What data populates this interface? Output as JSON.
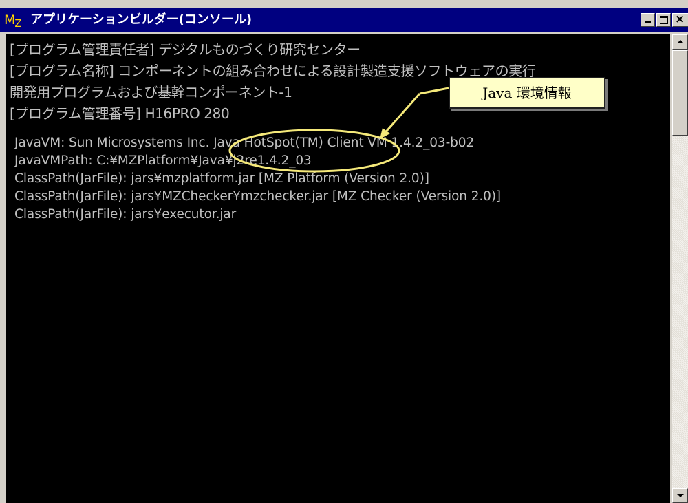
{
  "window": {
    "app_icon": "MZ",
    "title": "アプリケーションビルダー(コンソール)",
    "buttons": [
      "minimize",
      "maximize",
      "close"
    ]
  },
  "console": {
    "lines": [
      "[プログラム管理責任者] デジタルものづくり研究センター",
      "[プログラム名称] コンポーネントの組み合わせによる設計製造支援ソフトウェアの実行",
      "開発用プログラムおよび基幹コンポーネント-1",
      "[プログラム管理番号] H16PRO 280",
      "JavaVM: Sun Microsystems Inc. Java HotSpot(TM) Client VM 1.4.2_03-b02",
      "JavaVMPath: C:¥MZPlatform¥Java¥j2re1.4.2_03",
      "ClassPath(JarFile): jars¥mzplatform.jar [MZ Platform (Version 2.0)]",
      "ClassPath(JarFile): jars¥MZChecker¥mzchecker.jar [MZ Checker (Version 2.0)]",
      "ClassPath(JarFile): jars¥executor.jar"
    ]
  },
  "annotation": {
    "label": "Java 環境情報",
    "highlight_color": "#f5e97a",
    "arrow_color": "#f5e97a"
  },
  "colors": {
    "titlebar": "#000080",
    "console_bg": "#000000",
    "console_text": "#c0c0c0"
  }
}
